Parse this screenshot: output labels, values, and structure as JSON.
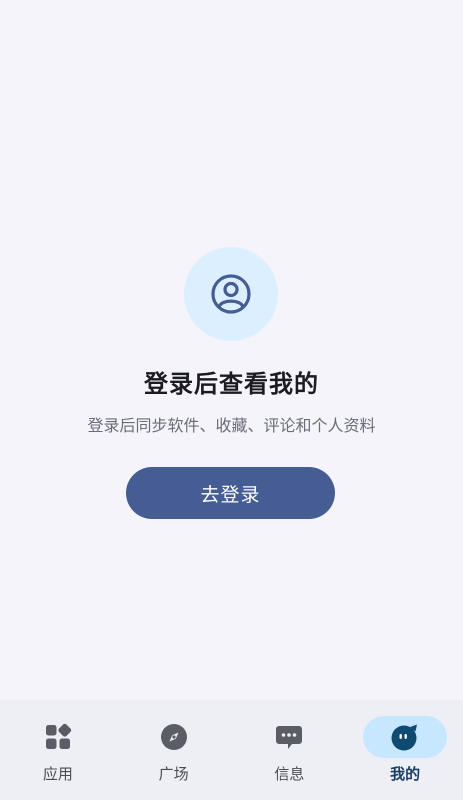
{
  "main": {
    "title": "登录后查看我的",
    "subtitle": "登录后同步软件、收藏、评论和个人资料",
    "login_button": "去登录"
  },
  "nav": {
    "items": [
      {
        "label": "应用",
        "icon": "apps-grid-icon"
      },
      {
        "label": "广场",
        "icon": "compass-icon"
      },
      {
        "label": "信息",
        "icon": "chat-bubble-icon"
      },
      {
        "label": "我的",
        "icon": "profile-face-icon",
        "active": true
      }
    ]
  },
  "colors": {
    "background": "#f4f4fa",
    "primary": "#455d92",
    "avatar_bg": "#dcefff",
    "nav_active_bg": "#c6e7ff"
  }
}
